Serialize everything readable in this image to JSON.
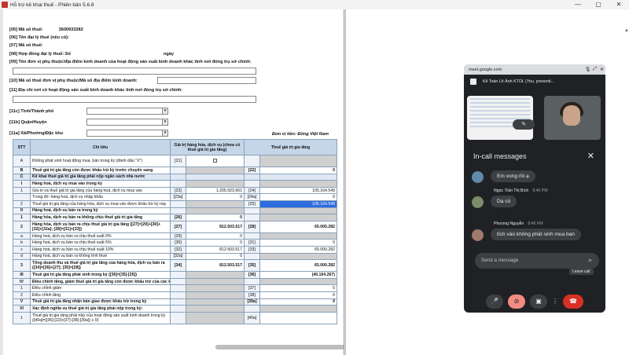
{
  "window": {
    "title": "Hỗ trợ kê khai thuế - Phiên bản 5.6.8",
    "controls": [
      "—",
      "▢",
      "✕"
    ]
  },
  "form": {
    "rows": [
      {
        "label": "[05] Mã số thuế:",
        "value": "3600933282"
      },
      {
        "label": "[06] Tên đại lý thuế (nếu có):",
        "value": ""
      },
      {
        "label": "[07] Mã số thuế:",
        "value": ""
      },
      {
        "label": "[08] Hợp đồng đại lý thuế: Số",
        "value": "ngày"
      },
      {
        "label": "[09] Tên đơn vị phụ thuộc/địa điểm kinh doanh của hoạt động sản xuất kinh doanh khác tỉnh nơi đóng trụ sở chính:",
        "value": ""
      },
      {
        "label": "[10] Mã số thuế đơn vị phụ thuộc/Mã số địa điểm kinh doanh:",
        "value": ""
      },
      {
        "label": "[11] Địa chỉ nơi có hoạt động sản xuất kinh doanh khác tỉnh nơi đóng trụ sở chính:",
        "value": ""
      },
      {
        "label": "[11c] Tỉnh/Thành phố",
        "value": ""
      },
      {
        "label": "[11b] Quận/Huyện",
        "value": ""
      },
      {
        "label": "[11a] Xã/Phường/Đặc khu",
        "value": ""
      }
    ],
    "currency_note": "Đơn vị tiền: Đồng Việt Nam"
  },
  "table": {
    "headers": [
      "STT",
      "Chỉ tiêu",
      "Giá trị hàng hóa, dịch vụ (chưa có thuế giá trị gia tăng)",
      "Thuế giá trị gia tăng"
    ],
    "rows": [
      {
        "stt": "A",
        "label": "Không phát sinh hoạt động mua, bán trong kỳ (đánh dấu \"X\")",
        "c1": "[21]",
        "v1": "",
        "c2": "",
        "v2": "",
        "style": "tall"
      },
      {
        "stt": "B",
        "label": "Thuế giá trị gia tăng còn được khấu trừ kỳ trước chuyển sang",
        "c1": "",
        "v1": "",
        "c2": "[22]",
        "v2": "0",
        "style": "bold"
      },
      {
        "stt": "C",
        "label": "Kê khai thuế giá trị gia tăng phải nộp ngân sách nhà nước",
        "c1": "",
        "v1": "",
        "c2": "",
        "v2": "",
        "style": "bold shade"
      },
      {
        "stt": "I",
        "label": "Hàng hoá, dịch vụ mua vào trong kỳ",
        "c1": "",
        "v1": "",
        "c2": "",
        "v2": "",
        "style": "bold"
      },
      {
        "stt": "1",
        "label": "Giá trị và thuế giá trị gia tăng của hàng hoá, dịch vụ mua vào",
        "c1": "[23]",
        "v1": "1.205.923.661",
        "c2": "[24]",
        "v2": "105.164.549",
        "style": ""
      },
      {
        "stt": "",
        "label": "Trong đó: hàng hoá, dịch vụ nhập khẩu",
        "c1": "[23a]",
        "v1": "0",
        "c2": "[24a]",
        "v2": "0",
        "style": ""
      },
      {
        "stt": "2",
        "label": "Thuế giá trị gia tăng của hàng hóa, dịch vụ mua vào được khấu trừ kỳ này",
        "c1": "",
        "v1": "",
        "c2": "[25]",
        "v2": "105.164.549",
        "style": "hl"
      },
      {
        "stt": "II",
        "label": "Hàng hoá, dịch vụ bán ra trong kỳ",
        "c1": "",
        "v1": "",
        "c2": "",
        "v2": "",
        "style": "bold"
      },
      {
        "stt": "1",
        "label": "Hàng hóa, dịch vụ bán ra không chịu thuế giá trị gia tăng",
        "c1": "[26]",
        "v1": "0",
        "c2": "",
        "v2": "",
        "style": "bold"
      },
      {
        "stt": "2",
        "label": "Hàng hóa, dịch vụ bán ra chịu thuế giá trị gia tăng ([27]=[29]+[30]+[32]+[32a]; [28]=[31]+[33])",
        "c1": "[27]",
        "v1": "812.503.517",
        "c2": "[28]",
        "v2": "65.000.282",
        "style": "bold tall"
      },
      {
        "stt": "a",
        "label": "Hàng hoá, dịch vụ bán ra chịu thuế suất 0%",
        "c1": "[29]",
        "v1": "0",
        "c2": "",
        "v2": "",
        "style": ""
      },
      {
        "stt": "b",
        "label": "Hàng hoá, dịch vụ bán ra chịu thuế suất 5%",
        "c1": "[30]",
        "v1": "0",
        "c2": "[31]",
        "v2": "0",
        "style": ""
      },
      {
        "stt": "c",
        "label": "Hàng hoá, dịch vụ bán ra chịu thuế suất 10%",
        "c1": "[32]",
        "v1": "812.503.517",
        "c2": "[33]",
        "v2": "65.000.282",
        "style": ""
      },
      {
        "stt": "d",
        "label": "Hàng hoá, dịch vụ bán ra không tính thuế",
        "c1": "[32a]",
        "v1": "0",
        "c2": "",
        "v2": "",
        "style": ""
      },
      {
        "stt": "3",
        "label": "Tổng doanh thu và thuế giá trị gia tăng của hàng hóa, dịch vụ bán ra ([34]=[26]+[27]; [35]=[28])",
        "c1": "[34]",
        "v1": "812.503.517",
        "c2": "[35]",
        "v2": "65.000.282",
        "style": "bold tall"
      },
      {
        "stt": "III",
        "label": "Thuế giá trị gia tăng phát sinh trong kỳ ([36]=[35]-[25])",
        "c1": "",
        "v1": "",
        "c2": "[36]",
        "v2": "(40.164.267)",
        "style": "bold"
      },
      {
        "stt": "IV",
        "label": "Điều chỉnh tăng, giảm thuế giá trị gia tăng còn được khấu trừ của các kỳ trước",
        "c1": "",
        "v1": "",
        "c2": "",
        "v2": "",
        "style": "bold"
      },
      {
        "stt": "1",
        "label": "Điều chỉnh giảm",
        "c1": "",
        "v1": "",
        "c2": "[37]",
        "v2": "0",
        "style": ""
      },
      {
        "stt": "2",
        "label": "Điều chỉnh tăng",
        "c1": "",
        "v1": "",
        "c2": "[38]",
        "v2": "0",
        "style": ""
      },
      {
        "stt": "V",
        "label": "Thuế giá trị gia tăng nhận bàn giao được khấu trừ trong kỳ",
        "c1": "",
        "v1": "",
        "c2": "[39a]",
        "v2": "0",
        "style": "bold"
      },
      {
        "stt": "VI",
        "label": "Xác định nghĩa vụ thuế giá trị gia tăng phải nộp trong kỳ:",
        "c1": "",
        "v1": "",
        "c2": "",
        "v2": "",
        "style": "bold"
      },
      {
        "stt": "1",
        "label": "Thuế giá trị gia tăng phải nộp của hoạt động sản xuất kinh doanh trong kỳ ([40a]=([36]-[22]+[37]-[38]-[39a]) ≥ 0)",
        "c1": "",
        "v1": "",
        "c2": "[40a]",
        "v2": "",
        "style": "tall"
      }
    ]
  },
  "meet": {
    "url": "meet.google.com",
    "presenting": "Kế Toán Lê Ánh KTOL (You, presenti...",
    "panel_title": "In-call messages",
    "messages": [
      {
        "sender": "",
        "time": "",
        "text": "Em xong rồi ạ"
      },
      {
        "sender": "Ngọc Trần Thị Bích",
        "time": "8:46 PM",
        "text": "Dạ có"
      },
      {
        "sender": "Phượng Nguyễn",
        "time": "8:46 PM",
        "text": "tích vào không phát sinh mua ban"
      }
    ],
    "send_placeholder": "Send a message",
    "leave_tooltip": "Leave call"
  },
  "colors": {
    "table_header": "#c5d6e8",
    "highlight": "#2d6cdf",
    "meet_bg": "#202124",
    "end_call": "#d93025"
  }
}
